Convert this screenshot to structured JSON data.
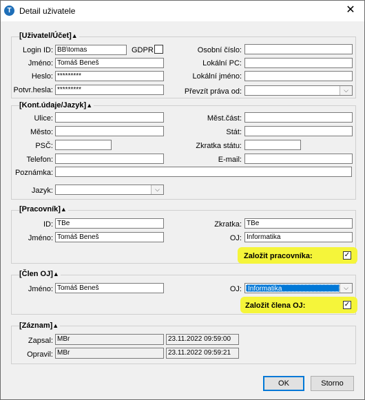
{
  "window": {
    "title": "Detail uživatele",
    "app_icon": "T",
    "close_icon": "✕"
  },
  "account": {
    "title": "[Uživatel/Účet]",
    "tri": "▲",
    "login_label": "Login ID:",
    "login_value": "BB\\tomas",
    "gdpr_label": "GDPR",
    "name_label": "Jméno:",
    "name_value": "Tomáš Beneš",
    "pwd_label": "Heslo:",
    "pwd_value": "*********",
    "pwd2_label": "Potvr.hesla:",
    "pwd2_value": "*********",
    "personal_no_label": "Osobní číslo:",
    "personal_no_value": "",
    "local_pc_label": "Lokální PC:",
    "local_pc_value": "",
    "local_name_label": "Lokální jméno:",
    "local_name_value": "",
    "rights_label": "Převzít práva od:",
    "rights_value": ""
  },
  "contact": {
    "title": "[Kont.údaje/Jazyk]",
    "tri": "▲",
    "street_label": "Ulice:",
    "city_label": "Město:",
    "zip_label": "PSČ:",
    "phone_label": "Telefon:",
    "note_label": "Poznámka:",
    "lang_label": "Jazyk:",
    "district_label": "Měst.část:",
    "country_label": "Stát:",
    "country_code_label": "Zkratka státu:",
    "email_label": "E-mail:",
    "street_value": "",
    "city_value": "",
    "zip_value": "",
    "phone_value": "",
    "note_value": "",
    "lang_value": "",
    "district_value": "",
    "country_value": "",
    "country_code_value": "",
    "email_value": ""
  },
  "worker": {
    "title": "[Pracovník]",
    "tri": "▲",
    "id_label": "ID:",
    "id_value": "TBe",
    "name_label": "Jméno:",
    "name_value": "Tomáš Beneš",
    "abbr_label": "Zkratka:",
    "abbr_value": "TBe",
    "oj_label": "OJ:",
    "oj_value": "Informatika",
    "create_label": "Založit pracovníka:",
    "create_checked": true
  },
  "member": {
    "title": "[Člen OJ]",
    "tri": "▲",
    "name_label": "Jméno:",
    "name_value": "Tomáš Beneš",
    "oj_label": "OJ:",
    "oj_value": "Informatika",
    "create_label": "Založit člena OJ:",
    "create_checked": true
  },
  "record": {
    "title": "[Záznam]",
    "tri": "▲",
    "written_label": "Zapsal:",
    "written_user": "MBr",
    "written_date": "23.11.2022 09:59:00",
    "edited_label": "Opravil:",
    "edited_user": "MBr",
    "edited_date": "23.11.2022 09:59:21"
  },
  "buttons": {
    "ok": "OK",
    "cancel": "Storno"
  },
  "highlight_color": "#f5f53a",
  "check_mark": "✓",
  "dropdown_icon": "⌵"
}
